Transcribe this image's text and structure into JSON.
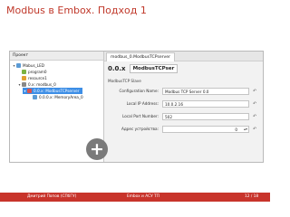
{
  "slide": {
    "title": "Modbus в Embox. Подход 1"
  },
  "tree": {
    "header": "Проект",
    "items": [
      {
        "label": "Mabus_LED",
        "twisty": "▾",
        "color": "#5b9bd5"
      },
      {
        "label": "program0",
        "twisty": "",
        "color": "#7cb342"
      },
      {
        "label": "resource1",
        "twisty": "",
        "color": "#e0a030"
      },
      {
        "label": "0.x: modbus_0",
        "twisty": "▾",
        "color": "#888888"
      },
      {
        "label": "0.0.x: ModbusTCPserver",
        "twisty": "▾",
        "color": "#d9534f"
      },
      {
        "label": "0.0.0.x: MemoryArea_0",
        "twisty": "",
        "color": "#5b9bd5"
      }
    ],
    "add_button": "+"
  },
  "editor": {
    "tab_label": "modbus_0.ModbusTCPserver",
    "device_id": "0.0.x",
    "device_name": "ModbusTCPser",
    "section_title": "ModbusTCP Slave",
    "props": [
      {
        "label": "Configuration Name:",
        "value": "Modbus TCP Server 0.0"
      },
      {
        "label": "Local IP Address:",
        "value": "10.0.2.16"
      },
      {
        "label": "Local Port Number:",
        "value": "502"
      },
      {
        "label": "Адрес устройства:",
        "value": "0"
      }
    ],
    "reset_glyph": "↶",
    "spin_glyph": "▴▾"
  },
  "footer": {
    "author": "Дмитрий Попов  (СПбГУ)",
    "center": "Embox и АСУ ТП",
    "page": "12 / 18"
  },
  "colors": {
    "title": "#c0392b",
    "footer": "#c8342b",
    "selection": "#3d8ee6"
  }
}
